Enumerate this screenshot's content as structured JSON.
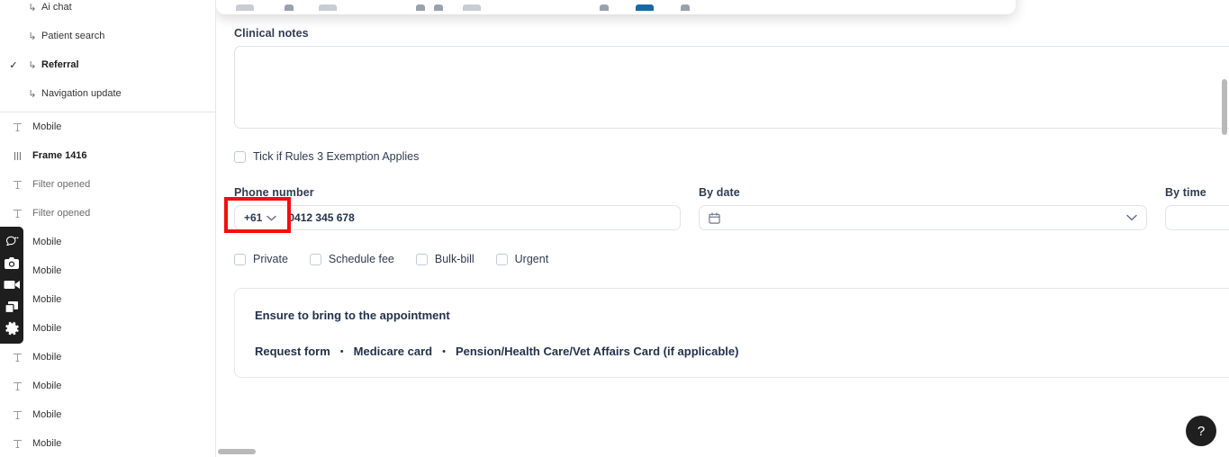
{
  "sidebar": {
    "flow_items": [
      {
        "label": "Ai chat",
        "arrow": "↳",
        "checked": false,
        "selected": false
      },
      {
        "label": "Patient search",
        "arrow": "↳",
        "checked": false,
        "selected": false
      },
      {
        "label": "Referral",
        "arrow": "↳",
        "checked": true,
        "selected": true,
        "check_glyph": "✓"
      },
      {
        "label": "Navigation update",
        "arrow": "↳",
        "checked": false,
        "selected": false
      }
    ],
    "layer_items": [
      {
        "label": "Mobile",
        "icon": "text-icon",
        "selected": false
      },
      {
        "label": "Frame 1416",
        "icon": "frame-icon",
        "selected": true
      },
      {
        "label": "Filter opened",
        "icon": "text-icon",
        "selected": false
      },
      {
        "label": "Filter opened",
        "icon": "text-icon",
        "selected": false
      },
      {
        "label": "Mobile",
        "icon": "text-icon",
        "selected": false
      },
      {
        "label": "Mobile",
        "icon": "text-icon",
        "selected": false
      },
      {
        "label": "Mobile",
        "icon": "text-icon",
        "selected": false
      },
      {
        "label": "Mobile",
        "icon": "text-icon",
        "selected": false
      },
      {
        "label": "Mobile",
        "icon": "text-icon",
        "selected": false
      },
      {
        "label": "Mobile",
        "icon": "text-icon",
        "selected": false
      },
      {
        "label": "Mobile",
        "icon": "text-icon",
        "selected": false
      },
      {
        "label": "Mobile",
        "icon": "text-icon",
        "selected": false
      }
    ]
  },
  "toolbar": {
    "items": [
      {
        "name": "annotate-pen-icon"
      },
      {
        "name": "camera-icon"
      },
      {
        "name": "video-record-icon"
      },
      {
        "name": "duplicate-frames-icon"
      },
      {
        "name": "settings-gear-icon"
      }
    ]
  },
  "form": {
    "clinical_notes": {
      "label": "Clinical notes",
      "value": "",
      "placeholder": ""
    },
    "rules_exemption": {
      "label": "Tick if Rules 3 Exemption Applies",
      "checked": false
    },
    "phone": {
      "label": "Phone number",
      "country_code": "+61",
      "value": "0412 345 678",
      "placeholder": "0412 345 678"
    },
    "by_date": {
      "label": "By date",
      "value": "",
      "placeholder": ""
    },
    "by_time": {
      "label": "By time",
      "value": "",
      "placeholder": ""
    },
    "options": [
      {
        "label": "Private",
        "checked": false
      },
      {
        "label": "Schedule fee",
        "checked": false
      },
      {
        "label": "Bulk-bill",
        "checked": false
      },
      {
        "label": "Urgent",
        "checked": false
      }
    ],
    "info_card": {
      "title": "Ensure to bring to the appointment",
      "separator": "•",
      "items": [
        "Request form",
        "Medicare card",
        "Pension/Health Care/Vet Affairs Card (if applicable)"
      ]
    }
  },
  "help": {
    "label": "?"
  },
  "colors": {
    "annotation_red": "#f60d0d",
    "accent_blue": "#1769a5",
    "text_navy": "#22324d",
    "toolbar_dark": "#1e1e1e"
  }
}
